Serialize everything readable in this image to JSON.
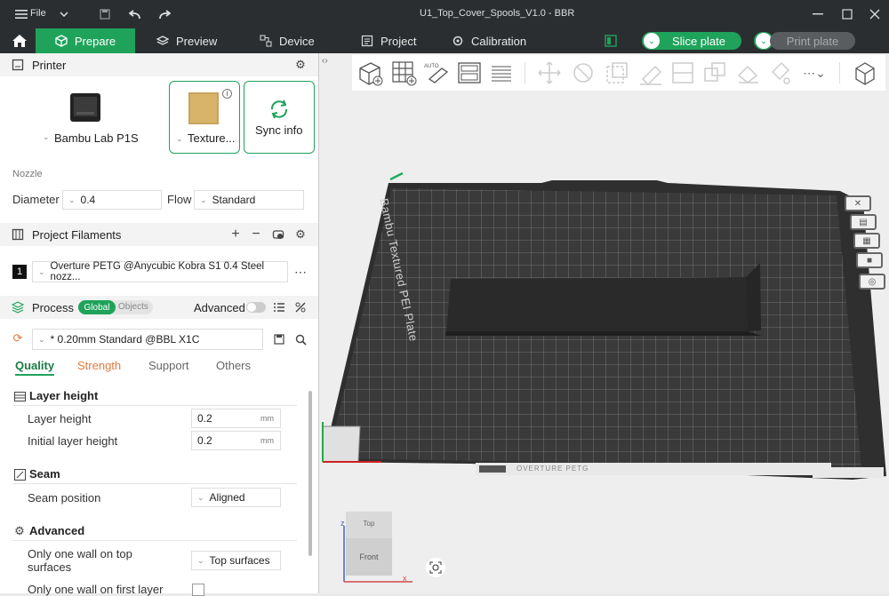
{
  "window": {
    "title": "U1_Top_Cover_Spools_V1.0 - BBR",
    "file_menu": "File"
  },
  "tabs": [
    {
      "label": "Prepare",
      "icon": "cube-icon"
    },
    {
      "label": "Preview",
      "icon": "layers-icon"
    },
    {
      "label": "Device",
      "icon": "device-icon"
    },
    {
      "label": "Project",
      "icon": "project-icon"
    },
    {
      "label": "Calibration",
      "icon": "calibration-icon"
    }
  ],
  "actions": {
    "slice": "Slice plate",
    "print": "Print plate"
  },
  "printer": {
    "section_title": "Printer",
    "printer_name": "Bambu Lab P1S",
    "plate_name": "Texture...",
    "sync_label": "Sync info",
    "nozzle_label": "Nozzle",
    "diameter_label": "Diameter",
    "diameter_value": "0.4",
    "flow_label": "Flow",
    "flow_value": "Standard"
  },
  "filaments": {
    "section_title": "Project Filaments",
    "items": [
      {
        "index": "1",
        "name": "Overture PETG @Anycubic Kobra S1 0.4 Steel nozz..."
      }
    ]
  },
  "process": {
    "section_title": "Process",
    "global_label": "Global",
    "objects_label": "Objects",
    "advanced_label": "Advanced",
    "preset": "* 0.20mm Standard @BBL X1C",
    "tabs": [
      "Quality",
      "Strength",
      "Support",
      "Others"
    ],
    "groups": [
      {
        "title": "Layer height",
        "rows": [
          {
            "label": "Layer height",
            "value": "0.2",
            "unit": "mm"
          },
          {
            "label": "Initial layer height",
            "value": "0.2",
            "unit": "mm"
          }
        ]
      },
      {
        "title": "Seam",
        "rows": [
          {
            "label": "Seam position",
            "value": "Aligned"
          }
        ]
      },
      {
        "title": "Advanced",
        "rows": [
          {
            "label": "Only one wall on top surfaces",
            "value": "Top surfaces"
          },
          {
            "label": "Only one wall on first layer",
            "value": ""
          }
        ]
      }
    ]
  },
  "viewport": {
    "plate_label": "Bambu Textured PEI Plate",
    "plate_filament": "OVERTURE PETG",
    "view_cube": {
      "top": "Top",
      "front": "Front"
    },
    "axes": {
      "x": "x",
      "z": "z"
    }
  },
  "colors": {
    "accent": "#1fa35b",
    "titlebar": "#2b2e31",
    "plate": "#3a3a3a"
  }
}
